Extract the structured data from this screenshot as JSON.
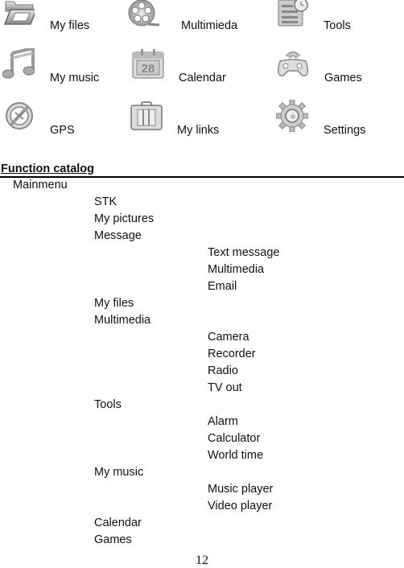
{
  "icon_grid": [
    {
      "label": "My files",
      "icon": "folder-icon"
    },
    {
      "label": "Multimieda",
      "icon": "film-reel-icon"
    },
    {
      "label": "Tools",
      "icon": "tools-clock-icon"
    },
    {
      "label": "My music",
      "icon": "music-note-icon"
    },
    {
      "label": "Calendar",
      "icon": "calendar-icon",
      "day": "28"
    },
    {
      "label": "Games",
      "icon": "gamepad-icon"
    },
    {
      "label": "GPS",
      "icon": "compass-icon"
    },
    {
      "label": "My links",
      "icon": "briefcase-icon"
    },
    {
      "label": "Settings",
      "icon": "gear-icon"
    }
  ],
  "catalog": {
    "heading": "Function catalog",
    "root": "Mainmenu",
    "items": [
      {
        "label": "STK",
        "level": 1
      },
      {
        "label": "My pictures",
        "level": 1
      },
      {
        "label": "Message",
        "level": 1
      },
      {
        "label": "Text message",
        "level": 2
      },
      {
        "label": "Multimedia",
        "level": 2
      },
      {
        "label": "Email",
        "level": 2
      },
      {
        "label": "My files",
        "level": 1
      },
      {
        "label": "Multimedia",
        "level": 1
      },
      {
        "label": "Camera",
        "level": 2
      },
      {
        "label": "Recorder",
        "level": 2
      },
      {
        "label": "Radio",
        "level": 2
      },
      {
        "label": "TV out",
        "level": 2
      },
      {
        "label": "Tools",
        "level": 1
      },
      {
        "label": "Alarm",
        "level": 2
      },
      {
        "label": "Calculator",
        "level": 2
      },
      {
        "label": "World time",
        "level": 2
      },
      {
        "label": "My music",
        "level": 1
      },
      {
        "label": "Music player",
        "level": 2
      },
      {
        "label": "Video player",
        "level": 2
      },
      {
        "label": "Calendar",
        "level": 1
      },
      {
        "label": "Games",
        "level": 1
      }
    ]
  },
  "page_number": "12"
}
